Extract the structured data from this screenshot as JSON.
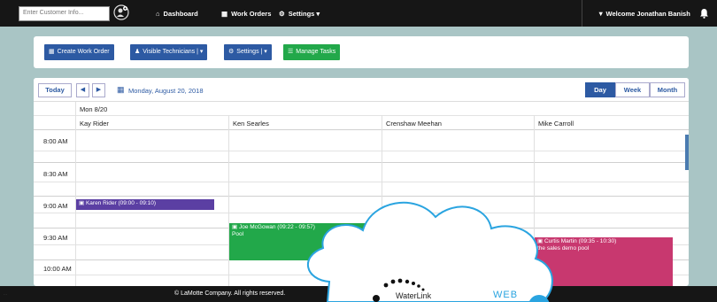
{
  "topnav": {
    "search_placeholder": "Enter Customer Info...",
    "items": [
      {
        "label": "Dashboard",
        "icon": "home-icon"
      },
      {
        "label": "Work Orders",
        "icon": "calendar-icon"
      },
      {
        "label": "Settings",
        "icon": "gear-icon"
      }
    ],
    "welcome": "Welcome Jonathan Banish"
  },
  "toolbar": {
    "create_work_order": "Create Work Order",
    "visible_technicians": "Visible Technicians |",
    "settings": "Settings |",
    "manage_tasks": "Manage Tasks"
  },
  "calendar": {
    "today": "Today",
    "prev": "◀",
    "next": "▶",
    "date": "Monday, August 20, 2018",
    "views": [
      "Day",
      "Week",
      "Month"
    ],
    "active_view": "Day",
    "day_header": "Mon 8/20",
    "technicians": [
      "Kay Rider",
      "Ken Searles",
      "Crenshaw Meehan",
      "Mike Carroll"
    ],
    "times": [
      "8:00 AM",
      "8:30 AM",
      "9:00 AM",
      "9:30 AM",
      "10:00 AM"
    ],
    "events": [
      {
        "title": "Karen Rider (09:00 - 09:10)",
        "sub": "",
        "color": "#5b3fa3"
      },
      {
        "title": "Joe McGowan (09:22 - 09:57)",
        "sub": "Pool",
        "color": "#22a84a"
      },
      {
        "title": "Curtis Martin (09:35 - 10:30)",
        "sub": "the sales demo pool",
        "color": "#c8386f"
      }
    ]
  },
  "footer": {
    "copyright": "© LaMotte Company. All rights reserved."
  },
  "overlay": {
    "brand": "WaterLink",
    "web": "WEB"
  },
  "colors": {
    "nav_bg": "#161616",
    "page_bg": "#a9c5c5",
    "primary": "#2d5aa3",
    "success": "#22a84a"
  }
}
